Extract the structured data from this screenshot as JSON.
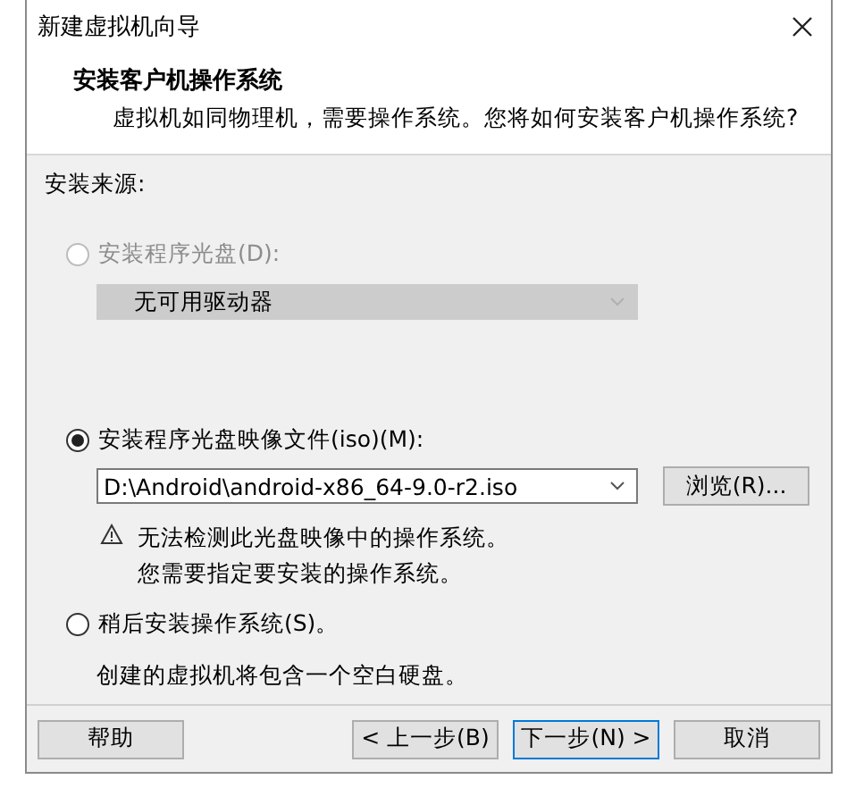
{
  "window": {
    "title": "新建虚拟机向导"
  },
  "header": {
    "title": "安装客户机操作系统",
    "subtitle": "虚拟机如同物理机，需要操作系统。您将如何安装客户机操作系统?"
  },
  "source_label": "安装来源:",
  "options": [
    {
      "kind": "disc",
      "label": "安装程序光盘(D):",
      "selected": false,
      "disabled": true,
      "dropdown": {
        "value": "无可用驱动器",
        "disabled": true
      }
    },
    {
      "kind": "iso",
      "label": "安装程序光盘映像文件(iso)(M):",
      "selected": true,
      "disabled": false,
      "path": {
        "value": "D:\\Android\\android-x86_64-9.0-r2.iso"
      },
      "browse": "浏览(R)...",
      "warning": [
        "无法检测此光盘映像中的操作系统。",
        "您需要指定要安装的操作系统。"
      ]
    },
    {
      "kind": "later",
      "label": "稍后安装操作系统(S)。",
      "selected": false,
      "disabled": false,
      "note": "创建的虚拟机将包含一个空白硬盘。"
    }
  ],
  "footer": {
    "help": "帮助",
    "nav": [
      {
        "label": "< 上一步(B)",
        "default": false
      },
      {
        "label": "下一步(N) >",
        "default": true
      },
      {
        "label": "取消",
        "default": false
      }
    ]
  }
}
